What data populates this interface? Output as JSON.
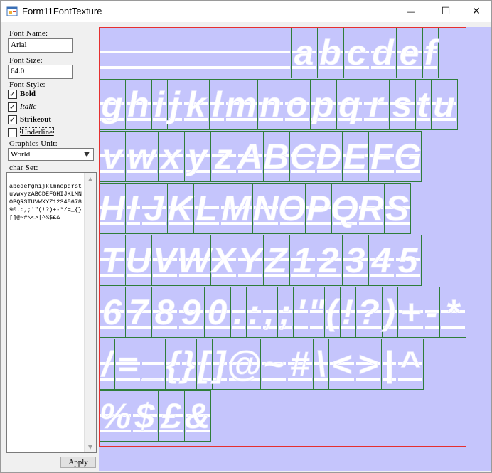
{
  "window": {
    "title": "Form11FontTexture",
    "minimize_glyph": "—",
    "maximize_glyph": "☐",
    "close_glyph": "✕"
  },
  "form": {
    "font_name_label": "Font Name:",
    "font_name_value": "Arial",
    "font_size_label": "Font Size:",
    "font_size_value": "64.0",
    "font_style_label": "Font Style:",
    "styles": [
      {
        "label": "Bold",
        "checked": true
      },
      {
        "label": "Italic",
        "checked": true
      },
      {
        "label": "Strikeout",
        "checked": true
      },
      {
        "label": "Underline",
        "checked": false
      }
    ],
    "graphics_unit_label": "Graphics Unit:",
    "graphics_unit_value": "World",
    "char_set_label": "char Set:",
    "char_set_value": "abcdefghijklmnopqrstuvwxyzABCDEFGHIJKLMNOPQRSTUVWXYZ1234567890.:,;'\"(!?)+-*/=_{}[]@~#\\<>|^%$£&",
    "apply_label": "Apply"
  },
  "texture": {
    "background": "#c5c5fc",
    "cell_border_color": "#2f7d3a",
    "atlas_border_color": "#e53030",
    "glyph_color": "#ffffff",
    "rows": [
      [
        "",
        "a",
        "b",
        "c",
        "d",
        "e",
        "f"
      ],
      [
        "g",
        "h",
        "i",
        "j",
        "k",
        "l",
        "m",
        "n",
        "o",
        "p",
        "q",
        "r",
        "s",
        "t",
        "u"
      ],
      [
        "v",
        "w",
        "x",
        "y",
        "z",
        "A",
        "B",
        "C",
        "D",
        "E",
        "F",
        "G"
      ],
      [
        "H",
        "I",
        "J",
        "K",
        "L",
        "M",
        "N",
        "O",
        "P",
        "Q",
        "R",
        "S"
      ],
      [
        "T",
        "U",
        "V",
        "W",
        "X",
        "Y",
        "Z",
        "1",
        "2",
        "3",
        "4",
        "5"
      ],
      [
        "6",
        "7",
        "8",
        "9",
        "0",
        ".",
        ":",
        ",",
        ";",
        "'",
        "\"",
        "(",
        "!",
        "?",
        ")",
        "+",
        "-",
        "*"
      ],
      [
        "/",
        "=",
        "_",
        "{",
        "}",
        "[",
        "]",
        "@",
        "~",
        "#",
        "\\",
        "<",
        ">",
        "|",
        "^"
      ],
      [
        "%",
        "$",
        "£",
        "&"
      ]
    ]
  }
}
